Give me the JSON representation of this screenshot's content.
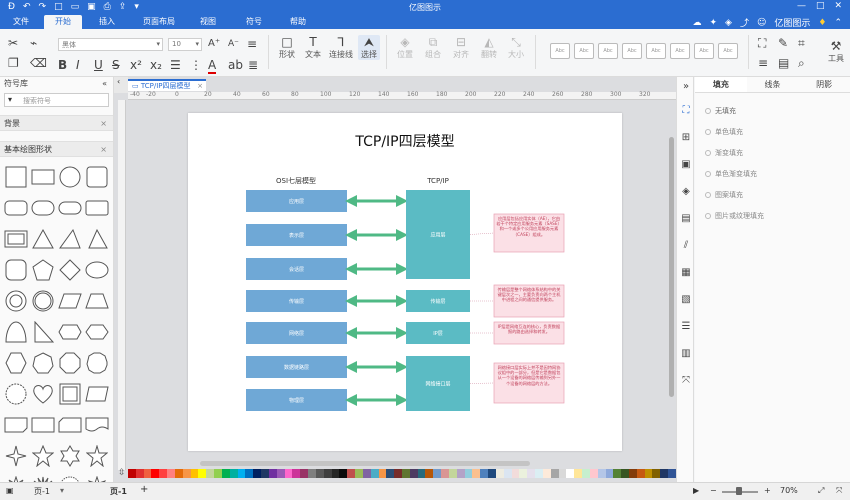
{
  "app_title": "亿图图示",
  "menu": {
    "tabs": [
      "文件",
      "开始",
      "插入",
      "页面布局",
      "视图",
      "符号",
      "帮助"
    ],
    "active_tab": "开始",
    "user_label": "亿图图示"
  },
  "toolbar": {
    "font_family": "黑体",
    "font_size": "10",
    "shape_label": "形状",
    "text_label": "文本",
    "connector_label": "连接线",
    "select_label": "选择",
    "position_label": "位置",
    "group_label": "组合",
    "align_label": "对齐",
    "rotate_label": "翻转",
    "size_label": "大小",
    "tools_label": "工具",
    "style_preview": "Abc"
  },
  "left_panel": {
    "title": "符号库",
    "search_placeholder": "搜索符号",
    "section_background": "背景",
    "section_basic": "基本绘图形状"
  },
  "document": {
    "tab_title": "TCP/IP四层模型",
    "ruler_start": "-40",
    "ruler_marks": [
      "-20",
      "0",
      "20",
      "40",
      "60",
      "80",
      "100",
      "120",
      "140",
      "160",
      "180",
      "200",
      "220",
      "240",
      "260",
      "280",
      "300",
      "320"
    ]
  },
  "diagram": {
    "title": "TCP/IP四层模型",
    "osi_header": "OSI七层模型",
    "tcp_header": "TCP/IP",
    "osi_layers": [
      "应用层",
      "表示层",
      "会话层",
      "传输层",
      "网络层",
      "数据链路层",
      "物理层"
    ],
    "tcp_layers": [
      "应用层",
      "传输层",
      "IP层",
      "网络接口层"
    ],
    "notes": [
      "应用层包括应用实体（AE），它由若干个特定应用服务元素（SASE）和一个或多个公用应用服务元素（CASE）组成。",
      "传输层是整个网络体系结构中的关键层次之一，主要负责向两个主机中进程之间的通信提供服务。",
      "IP层是网络互连的核心，负责数据报的路由选择和转发。",
      "网络接口层实际上并不是因特网协议组中的一部分，但是它是数据包从一个设备的网络层传输到另外一个设备的网络层的方法。"
    ],
    "colors": {
      "osi_box": "#6fa8d6",
      "tcp_box": "#5bbbc4",
      "arrow": "#4fb985",
      "note_bg": "#fbe0e6",
      "note_border": "#e8a0b4"
    }
  },
  "right_panel": {
    "tabs": [
      "填充",
      "线条",
      "阴影"
    ],
    "active_tab": "填充",
    "fill_options": [
      "无填充",
      "单色填充",
      "渐变填充",
      "单色渐变填充",
      "图案填充",
      "图片或纹理填充"
    ]
  },
  "status": {
    "page_selector": "页-1",
    "page_tab": "页-1",
    "add_page": "+",
    "zoom": "70%"
  },
  "palette_colors": [
    "#c00000",
    "#e03030",
    "#f06040",
    "#ff0000",
    "#ff4040",
    "#ff8080",
    "#e46c0a",
    "#f79646",
    "#ffc000",
    "#ffff00",
    "#c3d69b",
    "#92d050",
    "#00b050",
    "#00b0a0",
    "#00b0f0",
    "#0070c0",
    "#002060",
    "#1f3864",
    "#7030a0",
    "#9b59b6",
    "#ff66cc",
    "#cc3399",
    "#993366",
    "#7f7f7f",
    "#595959",
    "#3f3f3f",
    "#262626",
    "#0c0c0c",
    "#c0504d",
    "#9bbb59",
    "#8064a2",
    "#4bacc6",
    "#f79646",
    "#2c4d75",
    "#772c2a",
    "#5f7530",
    "#4d3b62",
    "#276a7c",
    "#b65708",
    "#729aca",
    "#d99694",
    "#c3d69b",
    "#b3a2c7",
    "#93cddd",
    "#fac08f",
    "#4f81bd",
    "#1f497d",
    "#eeece1",
    "#dbe5f1",
    "#f2dcdb",
    "#ebf1dd",
    "#e5e0ec",
    "#dbeef3",
    "#fdeada",
    "#a6a6a6",
    "#d9d9d9",
    "#ffffff",
    "#ffe699",
    "#c6efce",
    "#ffc7ce",
    "#b4c6e7",
    "#8ea9db",
    "#548235",
    "#375623",
    "#833c0b",
    "#c65911",
    "#bf8f00",
    "#806000",
    "#203764",
    "#305496"
  ]
}
